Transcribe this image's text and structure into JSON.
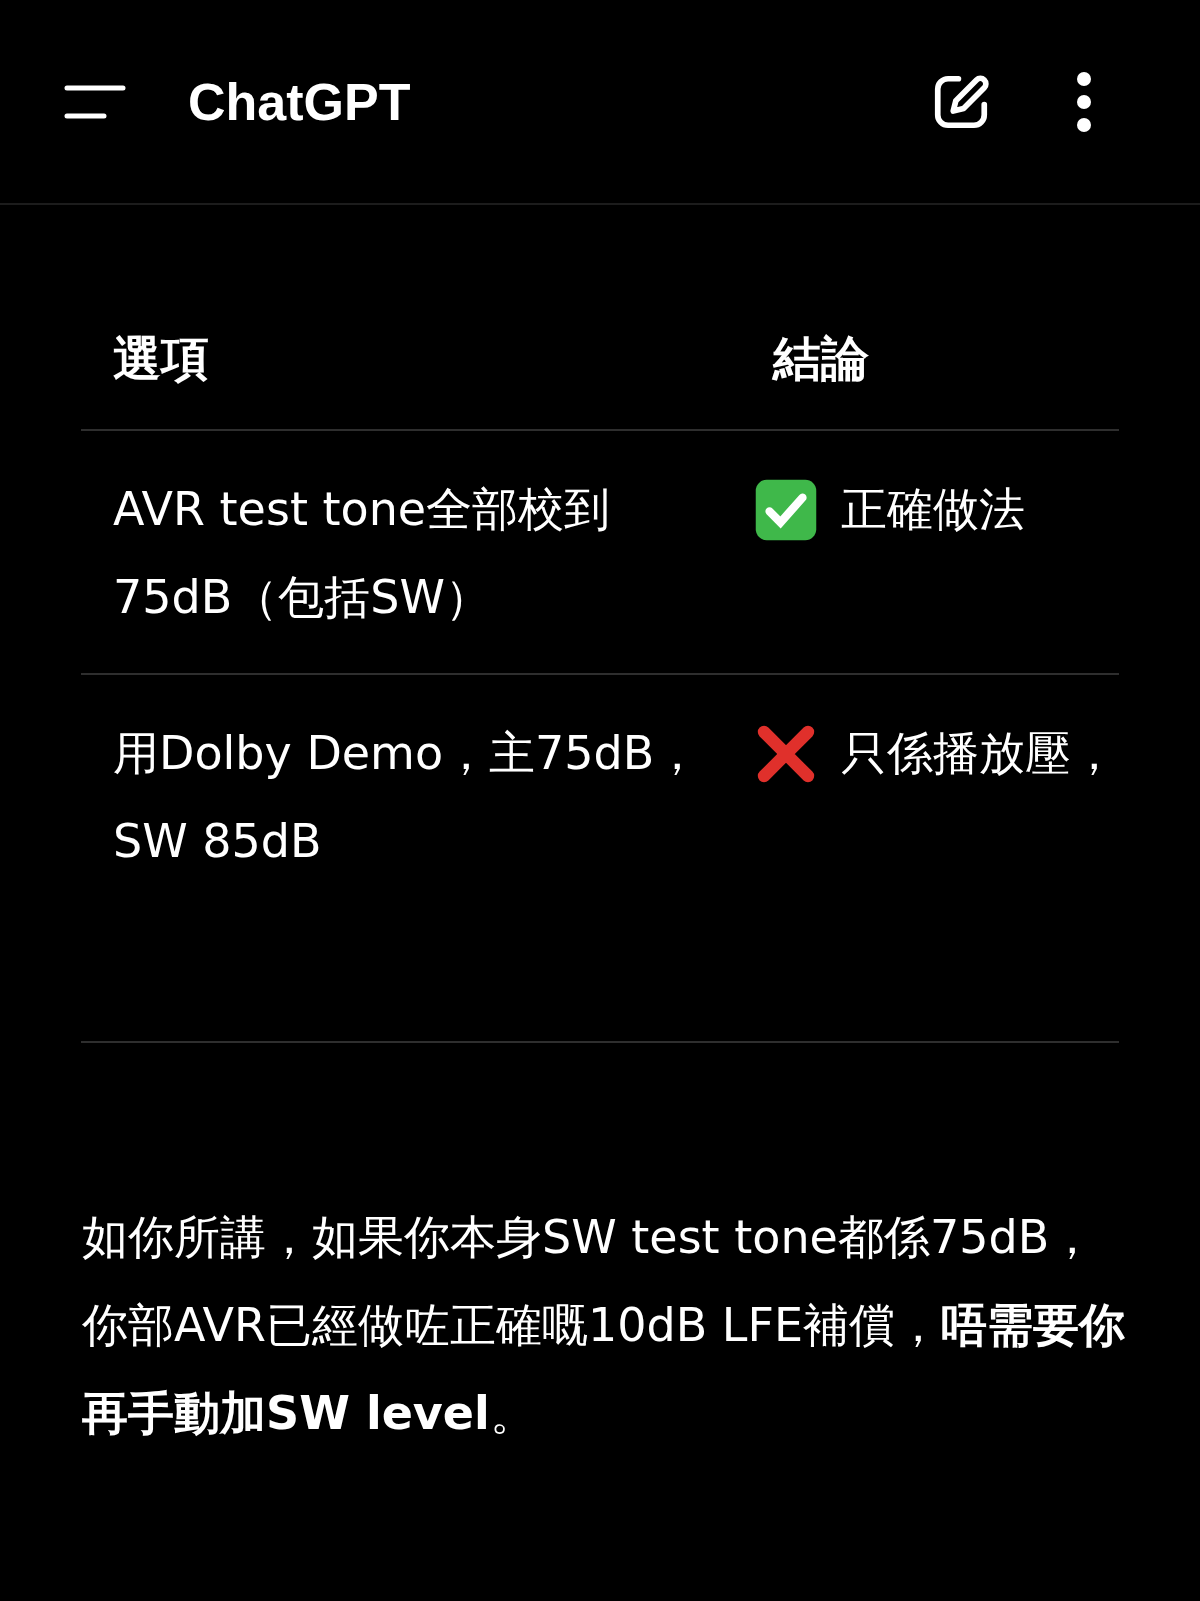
{
  "app_bar": {
    "title": "ChatGPT"
  },
  "table": {
    "columns": [
      "選項",
      "結論"
    ],
    "rows": [
      {
        "option": "AVR test tone全部校到75dB（包括SW）",
        "kind": "ok",
        "verdict": "正確做法"
      },
      {
        "option": "用Dolby Demo，主75dB，SW 85dB",
        "kind": "bad",
        "verdict": "只係播放壓，"
      }
    ]
  },
  "message": "如你所講，如果你本身SW test tone都係75dB，你部AVR已經做咗正確嘅10dB LFE補償，**唔需要你再手動加SW level**。"
}
